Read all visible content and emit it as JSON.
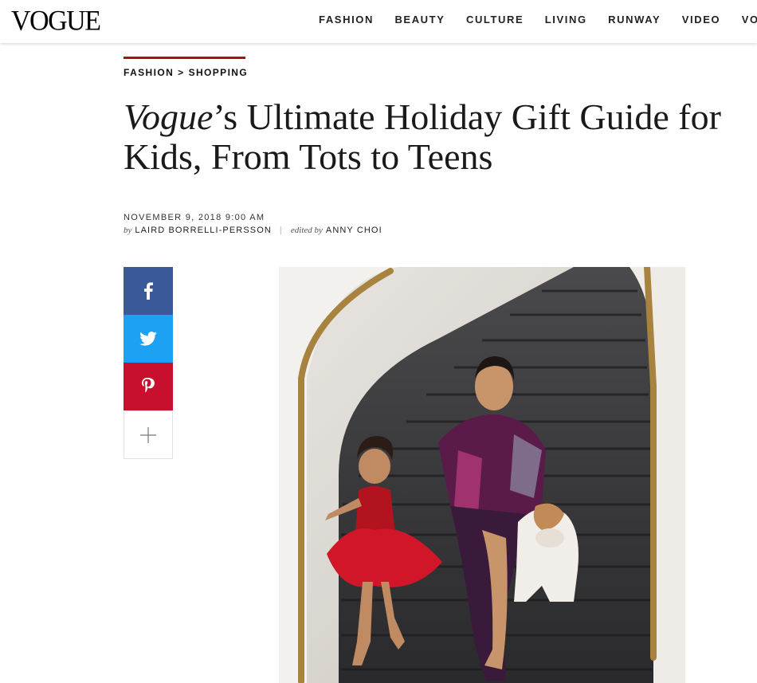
{
  "header": {
    "logo": "VOGUE",
    "nav": [
      "FASHION",
      "BEAUTY",
      "CULTURE",
      "LIVING",
      "RUNWAY",
      "VIDEO",
      "VOGUEWORLD"
    ]
  },
  "breadcrumb": {
    "section": "FASHION",
    "separator": ">",
    "subsection": "SHOPPING"
  },
  "article": {
    "title_italic": "Vogue",
    "title_rest": "’s Ultimate Holiday Gift Guide for Kids, From Tots to Teens",
    "date": "NOVEMBER 9, 2018 9:00 AM",
    "by_prefix": "by",
    "author": "LAIRD BORRELLI-PERSSON",
    "divider": "|",
    "edited_prefix": "edited by",
    "editor": "ANNY CHOI"
  },
  "share": {
    "icons": [
      "facebook-icon",
      "twitter-icon",
      "pinterest-icon",
      "plus-icon"
    ]
  },
  "colors": {
    "accent_red": "#a6121c",
    "facebook": "#3b5998",
    "twitter": "#1da1f2",
    "pinterest": "#c8102e"
  }
}
